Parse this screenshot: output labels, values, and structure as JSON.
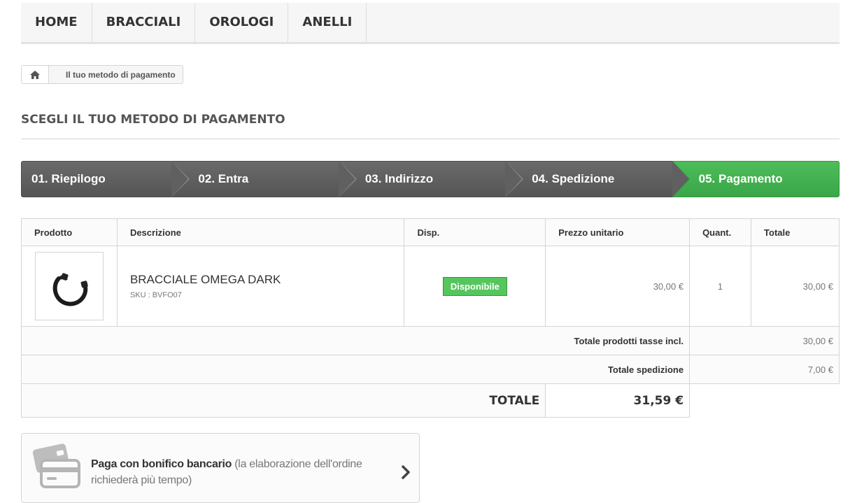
{
  "nav": {
    "items": [
      {
        "label": "HOME"
      },
      {
        "label": "BRACCIALI"
      },
      {
        "label": "OROLOGI"
      },
      {
        "label": "ANELLI"
      }
    ]
  },
  "breadcrumb": {
    "home_icon": "home-icon",
    "current": "Il tuo metodo di pagamento"
  },
  "page_title": "SCEGLI IL TUO METODO DI PAGAMENTO",
  "steps": [
    {
      "label": "01. Riepilogo",
      "active": false
    },
    {
      "label": "02. Entra",
      "active": false
    },
    {
      "label": "03. Indirizzo",
      "active": false
    },
    {
      "label": "04. Spedizione",
      "active": false
    },
    {
      "label": "05. Pagamento",
      "active": true
    }
  ],
  "cart": {
    "headers": {
      "product": "Prodotto",
      "description": "Descrizione",
      "availability": "Disp.",
      "unit_price": "Prezzo unitario",
      "quantity": "Quant.",
      "total": "Totale"
    },
    "items": [
      {
        "name": "BRACCIALE OMEGA DARK",
        "sku": "SKU : BVFO07",
        "availability": "Disponibile",
        "unit_price": "30,00 €",
        "quantity": "1",
        "total": "30,00 €"
      }
    ],
    "totals": {
      "products_label": "Totale prodotti tasse incl.",
      "products_value": "30,00 €",
      "shipping_label": "Totale spedizione",
      "shipping_value": "7,00 €",
      "grand_label": "TOTALE",
      "grand_value": "31,59 €"
    }
  },
  "payment": {
    "title": "Paga con bonifico bancario",
    "note": "(la elaborazione dell'ordine richiederà più tempo)",
    "icon": "credit-card-icon"
  },
  "colors": {
    "accent_green": "#46b450",
    "step_gray": "#5f5f5f"
  }
}
